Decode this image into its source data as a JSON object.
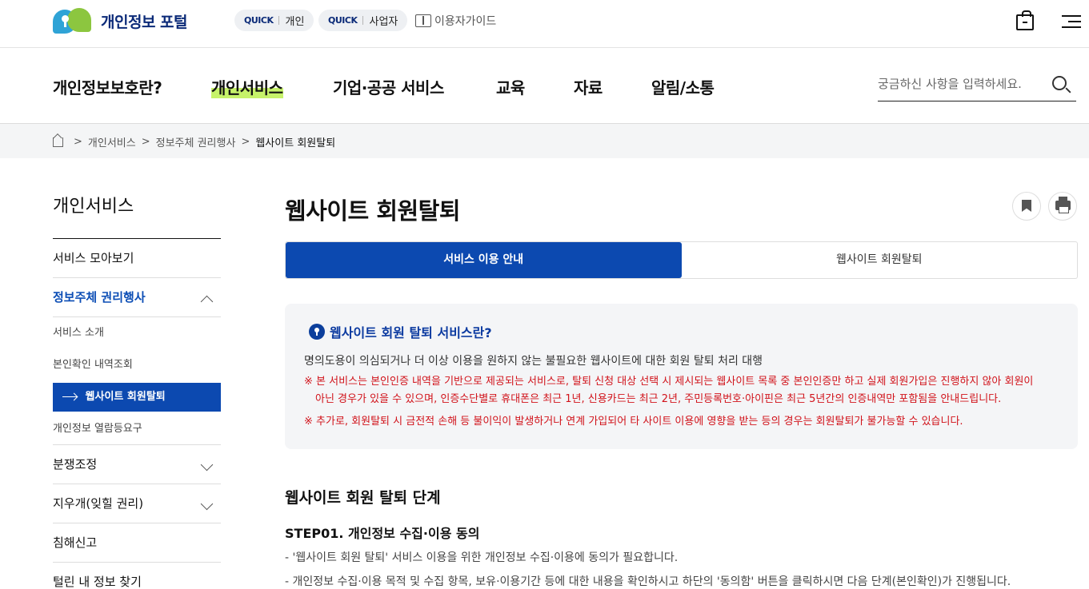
{
  "header": {
    "logo_text": "개인정보 포털",
    "quick_personal": {
      "tag": "QUICK",
      "label": "개인"
    },
    "quick_business": {
      "tag": "QUICK",
      "label": "사업자"
    },
    "guide_label": "이용자가이드"
  },
  "nav": {
    "items": [
      "개인정보보호란?",
      "개인서비스",
      "기업·공공 서비스",
      "교육",
      "자료",
      "알림/소통"
    ],
    "active_index": 1,
    "search_placeholder": "궁금하신 사항을 입력하세요."
  },
  "breadcrumb": [
    "개인서비스",
    "정보주체 권리행사",
    "웹사이트 회원탈퇴"
  ],
  "sidebar": {
    "title": "개인서비스",
    "items": [
      {
        "label": "서비스 모아보기"
      },
      {
        "label": "정보주체 권리행사"
      },
      {
        "label": "분쟁조정"
      },
      {
        "label": "지우개(잊힐 권리)"
      },
      {
        "label": "침해신고"
      },
      {
        "label": "털린 내 정보 찾기"
      }
    ],
    "sub_items": [
      "서비스 소개",
      "본인확인 내역조회",
      "웹사이트 회원탈퇴",
      "개인정보 열람등요구"
    ]
  },
  "main": {
    "page_title": "웹사이트 회원탈퇴",
    "tabs": [
      "서비스 이용 안내",
      "웹사이트 회원탈퇴"
    ],
    "info": {
      "title": "웹사이트 회원 탈퇴 서비스란?",
      "desc": "명의도용이 의심되거나 더 이상 이용을 원하지 않는 불필요한 웹사이트에 대한 회원 탈퇴 처리 대행",
      "notice1_line1": "※ 본 서비스는 본인인증 내역을 기반으로 제공되는 서비스로, 탈퇴 신청 대상 선택 시 제시되는 웹사이트 목록 중 본인인증만 하고 실제 회원가입은 진행하지 않아 회원이",
      "notice1_line2": "아닌 경우가 있을 수 있으며, 인증수단별로 휴대폰은 최근 1년, 신용카드는 최근 2년, 주민등록번호·아이핀은 최근 5년간의 인증내역만 포함됨을 안내드립니다.",
      "notice2": "※ 추가로, 회원탈퇴 시 금전적 손해 등 불이익이 발생하거나 연계 가입되어 타 사이트 이용에 영향을 받는 등의 경우는 회원탈퇴가 불가능할 수 있습니다."
    },
    "section_title": "웹사이트 회원 탈퇴 단계",
    "step1": {
      "title": "STEP01. 개인정보 수집·이용 동의",
      "lines": [
        "- '웹사이트 회원 탈퇴' 서비스 이용을 위한 개인정보 수집·이용에 동의가 필요합니다.",
        "- 개인정보 수집·이용 목적 및 수집 항목, 보유·이용기간 등에 대한 내용을 확인하시고 하단의 '동의함' 버튼을 클릭하시면 다음 단계(본인확인)가 진행됩니다."
      ]
    }
  }
}
